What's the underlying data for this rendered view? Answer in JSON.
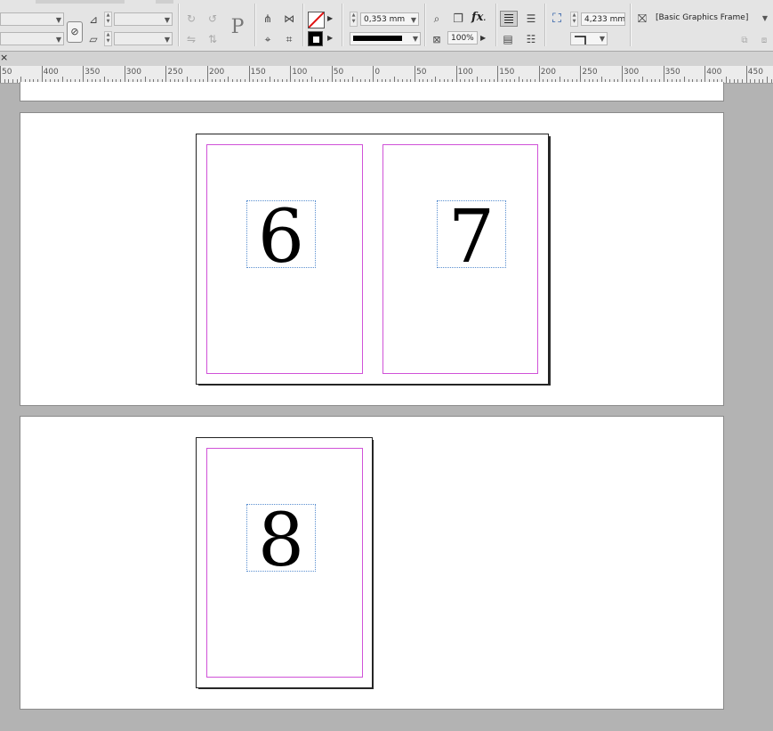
{
  "control_panel": {
    "stroke_weight": "0,353 mm",
    "opacity": "100%",
    "fitting_offset": "4,233 mm",
    "object_style": "[Basic Graphics Frame]",
    "reference_point_label": "P"
  },
  "ruler": {
    "close_label": "×",
    "labels": [
      "50",
      "400",
      "350",
      "300",
      "250",
      "200",
      "150",
      "100",
      "50",
      "0",
      "50",
      "100",
      "150",
      "200",
      "250",
      "300",
      "350",
      "400",
      "450"
    ]
  },
  "pages": {
    "page_6": "6",
    "page_7": "7",
    "page_8": "8"
  },
  "colors": {
    "margin_guide": "#d052d8",
    "frame_edge": "#5a8fd0",
    "pasteboard": "#b3b3b3"
  }
}
